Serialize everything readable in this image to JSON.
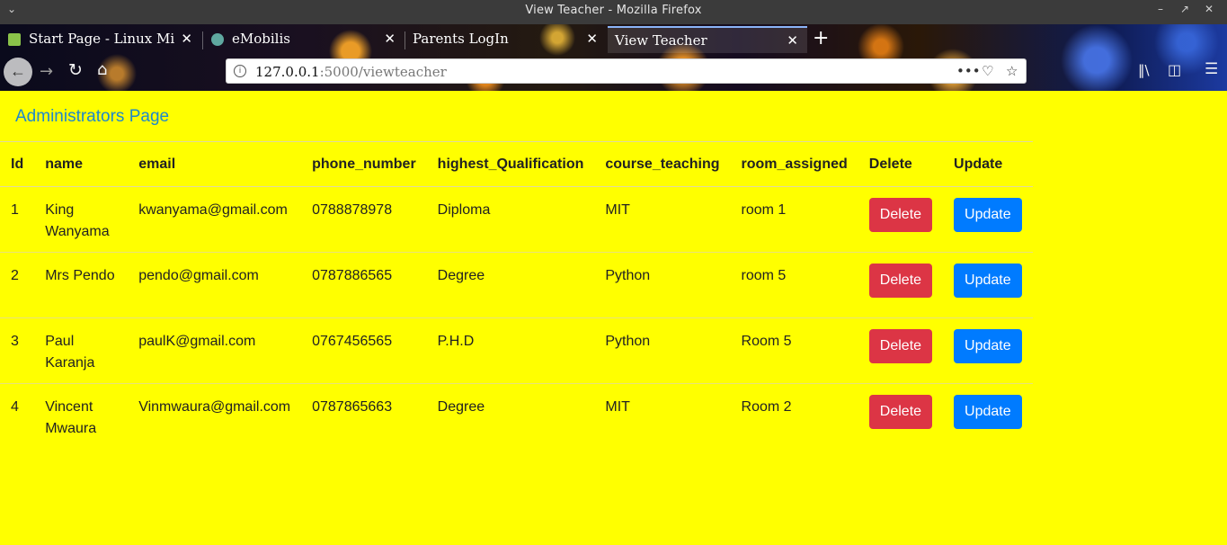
{
  "window": {
    "title": "View Teacher - Mozilla Firefox"
  },
  "tabs": [
    {
      "label": "Start Page - Linux Mi",
      "favicon_color": "#8bc34a",
      "active": false
    },
    {
      "label": "eMobilis",
      "favicon_color": "#5fa8a0",
      "active": false
    },
    {
      "label": "Parents LogIn",
      "favicon_color": "",
      "active": false
    },
    {
      "label": "View Teacher",
      "favicon_color": "",
      "active": true
    }
  ],
  "nav": {
    "url_host": "127.0.0.1",
    "url_path": ":5000/viewteacher"
  },
  "page": {
    "title": "Administrators Page",
    "accent_color": "#1e88cc",
    "background_color": "#ffff00"
  },
  "table": {
    "headers": [
      "Id",
      "name",
      "email",
      "phone_number",
      "highest_Qualification",
      "course_teaching",
      "room_assigned",
      "Delete",
      "Update"
    ],
    "rows": [
      {
        "id": "1",
        "name": "King Wanyama",
        "email": "kwanyama@gmail.com",
        "phone": "0788878978",
        "qualification": "Diploma",
        "course": "MIT",
        "room": "room 1"
      },
      {
        "id": "2",
        "name": "Mrs Pendo",
        "email": "pendo@gmail.com",
        "phone": "0787886565",
        "qualification": "Degree",
        "course": "Python",
        "room": "room 5"
      },
      {
        "id": "3",
        "name": "Paul Karanja",
        "email": "paulK@gmail.com",
        "phone": "0767456565",
        "qualification": "P.H.D",
        "course": "Python",
        "room": "Room 5"
      },
      {
        "id": "4",
        "name": "Vincent Mwaura",
        "email": "Vinmwaura@gmail.com",
        "phone": "0787865663",
        "qualification": "Degree",
        "course": "MIT",
        "room": "Room 2"
      }
    ],
    "delete_label": "Delete",
    "update_label": "Update",
    "delete_color": "#dc3545",
    "update_color": "#007bff"
  }
}
